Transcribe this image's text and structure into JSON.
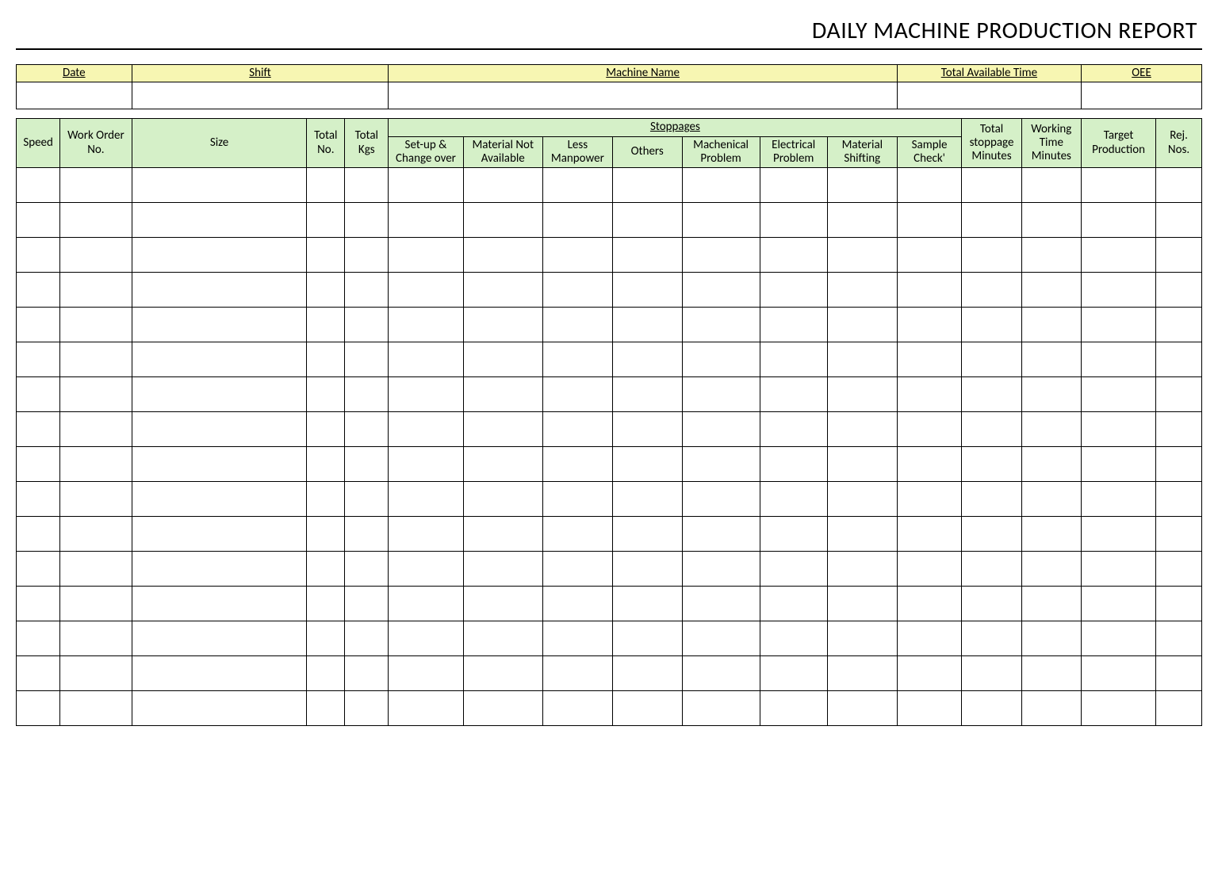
{
  "title": "DAILY MACHINE PRODUCTION REPORT",
  "info_headers": {
    "date": "Date",
    "shift": "Shift",
    "machine_name": "Machine Name",
    "total_available_time": "Total Available Time",
    "oee": "OEE"
  },
  "info_values": {
    "date": "",
    "shift": "",
    "machine_name": "",
    "total_available_time": "",
    "oee": ""
  },
  "columns": {
    "speed": "Speed",
    "work_order_no": "Work Order No.",
    "size": "Size",
    "total_no": "Total No.",
    "total_kgs": "Total Kgs",
    "stoppages_group": "Stoppages",
    "setup_changeover": "Set-up & Change over",
    "material_not_available": "Material Not Available",
    "less_manpower": "Less Manpower",
    "others": "Others",
    "machenical_problem": "Machenical Problem",
    "electrical_problem": "Electrical Problem",
    "material_shifting": "Material Shifting",
    "sample_check": "Sample Check'",
    "total_stoppage_minutes": "Total stoppage Minutes",
    "working_time_minutes": "Working Time Minutes",
    "target_production": "Target Production",
    "rej_nos": "Rej. Nos."
  },
  "data_rows": 16
}
